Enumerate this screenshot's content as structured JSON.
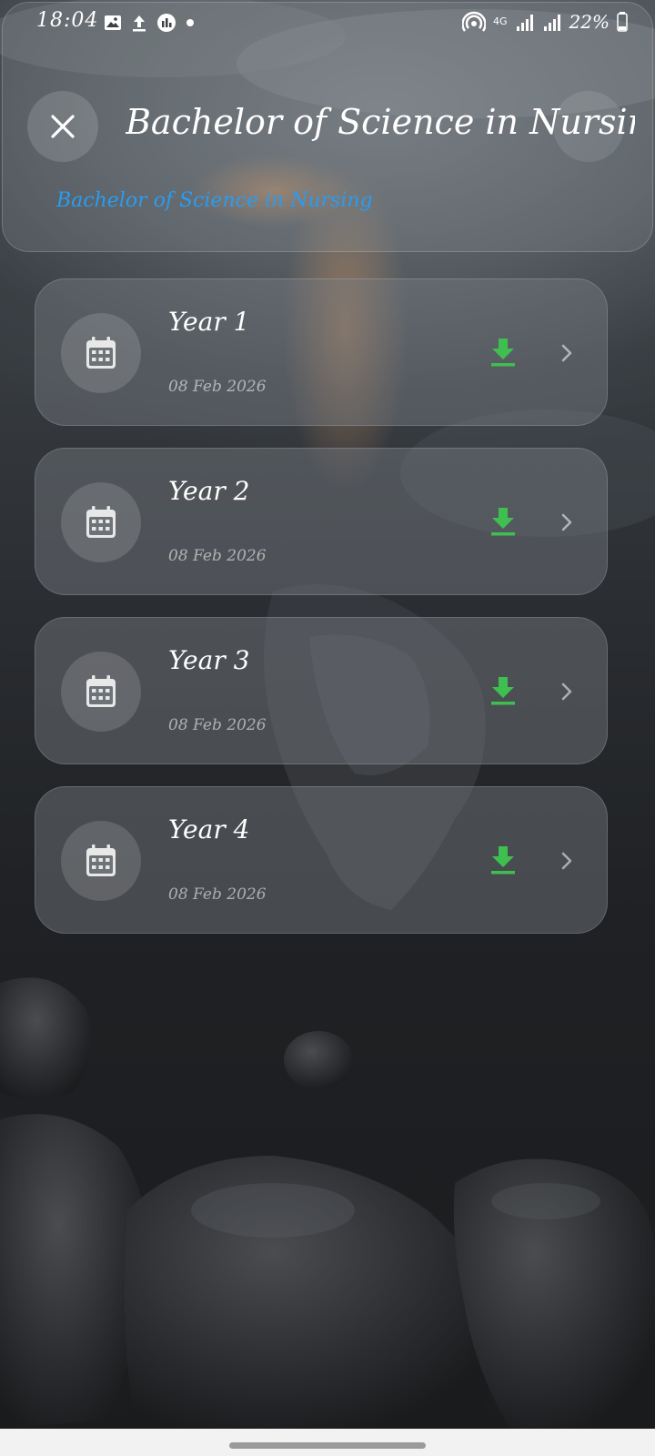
{
  "status_bar": {
    "time": "18:04",
    "network": "4G",
    "battery": "22%"
  },
  "header": {
    "title": "Bachelor of Science in Nursing",
    "subtitle": "Bachelor of Science in Nursing"
  },
  "years": [
    {
      "title": "Year 1",
      "date": "08 Feb 2026"
    },
    {
      "title": "Year 2",
      "date": "08 Feb 2026"
    },
    {
      "title": "Year 3",
      "date": "08 Feb 2026"
    },
    {
      "title": "Year 4",
      "date": "08 Feb 2026"
    }
  ],
  "colors": {
    "subtitle_accent": "#2a9cf0",
    "download_green": "#3fbf4f"
  },
  "icons": {
    "close": "close-icon",
    "year": "calendar-icon",
    "download": "download-icon",
    "open": "chevron-right-icon"
  }
}
